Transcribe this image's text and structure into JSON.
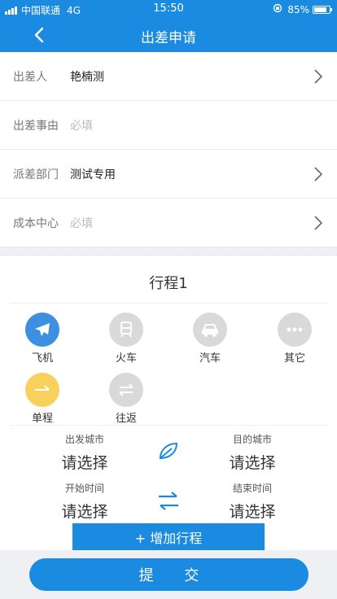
{
  "status": {
    "carrier": "中国联通",
    "network": "4G",
    "time": "15:50",
    "battery": "85%",
    "battery_level": 0.85
  },
  "nav": {
    "title": "出差申请"
  },
  "form": {
    "traveler_label": "出差人",
    "traveler_value": "艳楠测",
    "reason_label": "出差事由",
    "reason_placeholder": "必填",
    "dept_label": "派差部门",
    "dept_value": "测试专用",
    "cost_label": "成本中心",
    "cost_placeholder": "必填"
  },
  "trip": {
    "title": "行程1",
    "modes": [
      "飞机",
      "火车",
      "汽车",
      "其它"
    ],
    "trip_types": [
      "单程",
      "往返"
    ],
    "from_city_label": "出发城市",
    "from_city_value": "请选择",
    "to_city_label": "目的城市",
    "to_city_value": "请选择",
    "start_time_label": "开始时间",
    "start_time_value": "请选择",
    "end_time_label": "结束时间",
    "end_time_value": "请选择",
    "add_label": "+ 增加行程"
  },
  "submit_label": "提 交",
  "colors": {
    "primary": "#1a8be0",
    "selected_mode": "#3d8fe0",
    "selected_trip_type": "#f8d15d",
    "inactive": "#d9d9d9"
  },
  "icons": [
    "signal-icon",
    "back-icon",
    "chevron-right-icon",
    "plane-icon",
    "train-icon",
    "car-icon",
    "more-icon",
    "oneway-icon",
    "roundtrip-icon",
    "swap-city-icon",
    "swap-time-icon"
  ]
}
